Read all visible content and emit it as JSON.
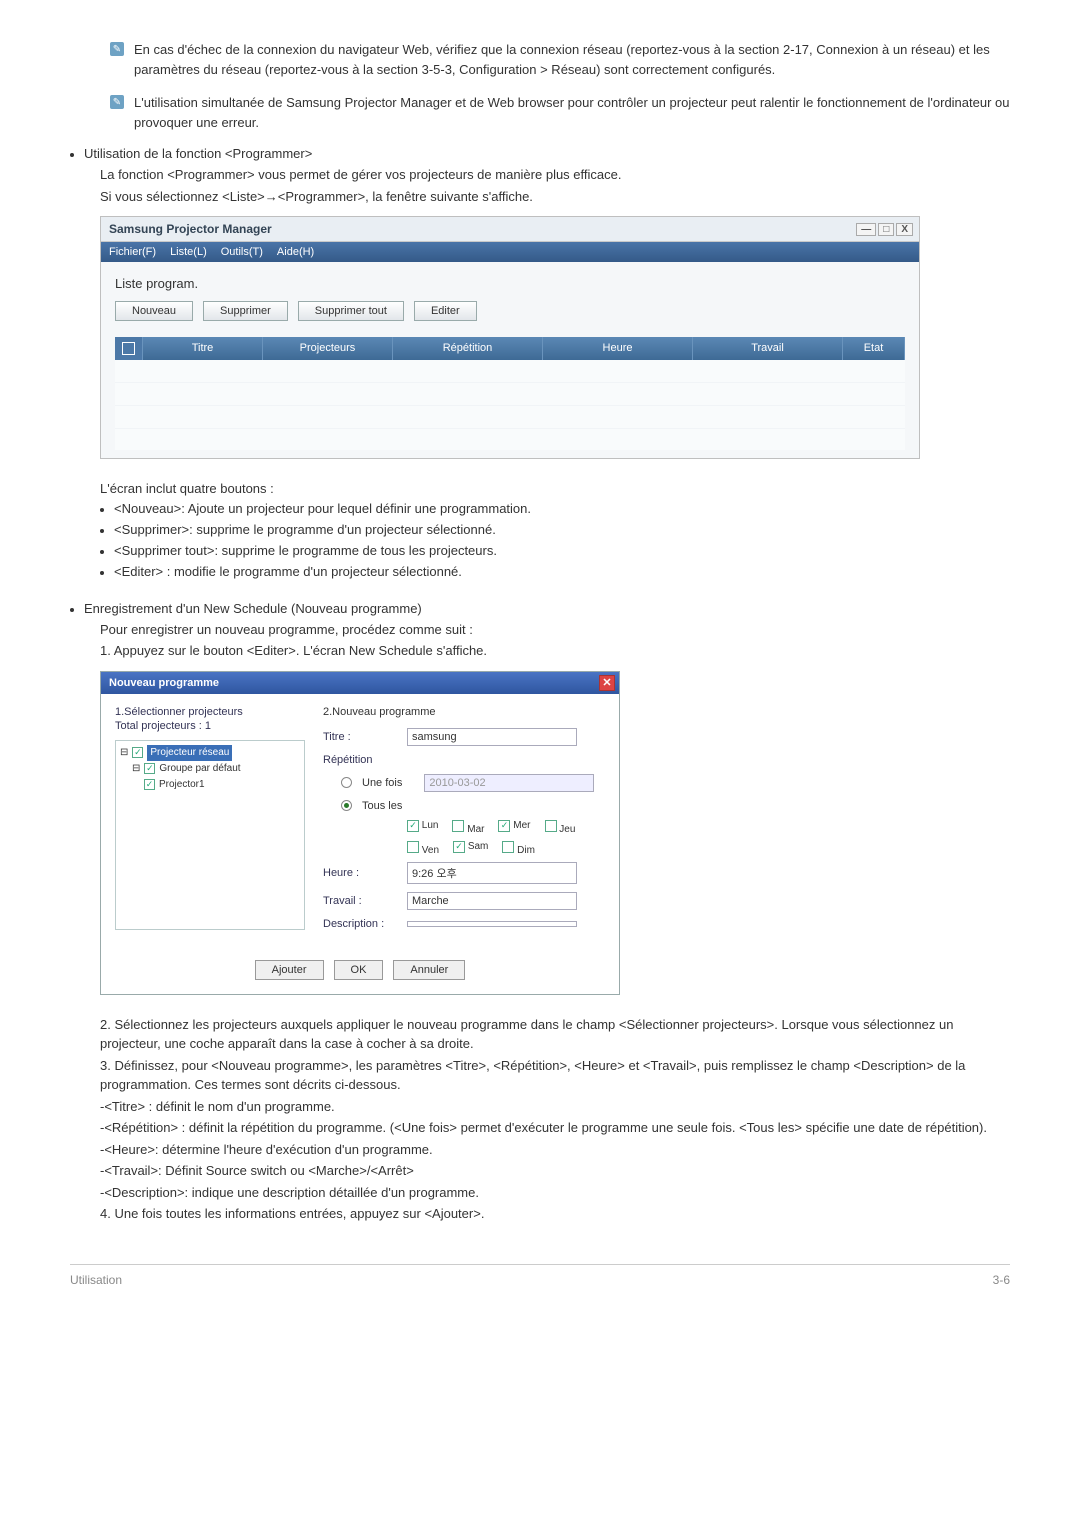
{
  "notes": {
    "n1": "En cas d'échec de la connexion du navigateur Web, vérifiez que la connexion réseau (reportez-vous à la section 2-17, Connexion à un réseau) et les paramètres du réseau (reportez-vous à la section 3-5-3, Configuration > Réseau) sont correctement configurés.",
    "n2": "L'utilisation simultanée de Samsung Projector Manager et de Web browser pour contrôler un projecteur peut ralentir le fonctionnement de l'ordinateur ou provoquer une erreur."
  },
  "section1": {
    "title": "Utilisation de la fonction <Programmer>",
    "p1": "La fonction <Programmer> vous permet de gérer vos projecteurs de manière plus efficace.",
    "p2": "Si vous sélectionnez <Liste>→<Programmer>, la fenêtre suivante s'affiche."
  },
  "fig1": {
    "wintitle": "Samsung Projector Manager",
    "menu": [
      "Fichier(F)",
      "Liste(L)",
      "Outils(T)",
      "Aide(H)"
    ],
    "listLabel": "Liste program.",
    "buttons": [
      "Nouveau",
      "Supprimer",
      "Supprimer tout",
      "Editer"
    ],
    "columns": [
      "Titre",
      "Projecteurs",
      "Répétition",
      "Heure",
      "Travail",
      "Etat"
    ],
    "winbtn_min": "—",
    "winbtn_max": "□",
    "winbtn_close": "X"
  },
  "after1": {
    "lead": "L'écran inclut quatre boutons :",
    "items": [
      "<Nouveau>: Ajoute un projecteur pour lequel définir une programmation.",
      "<Supprimer>: supprime le programme d'un projecteur sélectionné.",
      "<Supprimer tout>: supprime le programme de tous les projecteurs.",
      "<Editer> : modifie le programme d'un projecteur sélectionné."
    ]
  },
  "section2": {
    "title": "Enregistrement d'un New Schedule (Nouveau programme)",
    "p1": "Pour enregistrer un nouveau programme, procédez comme suit :",
    "p2": "1. Appuyez sur le bouton <Editer>. L'écran New Schedule s'affiche."
  },
  "fig2": {
    "wintitle": "Nouveau programme",
    "leftHeader": "1.Sélectionner projecteurs",
    "totalLabel": "Total projecteurs :     1",
    "tree": {
      "l1": "Projecteur réseau",
      "l2": "Groupe par défaut",
      "l3": "Projector1"
    },
    "rightHeader": "2.Nouveau programme",
    "labels": {
      "titre": "Titre :",
      "rep": "Répétition",
      "une": "Une fois",
      "tous": "Tous les",
      "heure": "Heure :",
      "trav": "Travail :",
      "desc": "Description :"
    },
    "values": {
      "titre": "samsung",
      "date": "2010-03-02",
      "heure": "9:26 오후",
      "trav": "Marche"
    },
    "days": {
      "lun": "Lun",
      "mar": "Mar",
      "mer": "Mer",
      "jeu": "Jeu",
      "ven": "Ven",
      "sam": "Sam",
      "dim": "Dim"
    },
    "buttons": {
      "add": "Ajouter",
      "ok": "OK",
      "cancel": "Annuler"
    }
  },
  "after2": {
    "p2": "2. Sélectionnez les projecteurs auxquels appliquer le nouveau programme dans le champ <Sélectionner projecteurs>. Lorsque vous sélectionnez un projecteur, une coche apparaît dans la case à cocher à sa droite.",
    "p3": "3. Définissez, pour <Nouveau programme>, les paramètres <Titre>, <Répétition>, <Heure> et <Travail>, puis remplissez le champ <Description> de la programmation. Ces termes sont décrits ci-dessous.",
    "d_titre": "-<Titre> : définit le nom d'un programme.",
    "d_rep": "-<Répétition> : définit la répétition du programme. (<Une fois> permet d'exécuter le programme une seule fois. <Tous les> spécifie une date de répétition).",
    "d_heure": "-<Heure>: détermine l'heure d'exécution d'un programme.",
    "d_trav": "-<Travail>: Définit Source switch ou <Marche>/<Arrêt>",
    "d_desc": "-<Description>: indique une description détaillée d'un programme.",
    "p4": "4. Une fois toutes les informations entrées, appuyez sur <Ajouter>."
  },
  "footer": {
    "left": "Utilisation",
    "right": "3-6"
  }
}
